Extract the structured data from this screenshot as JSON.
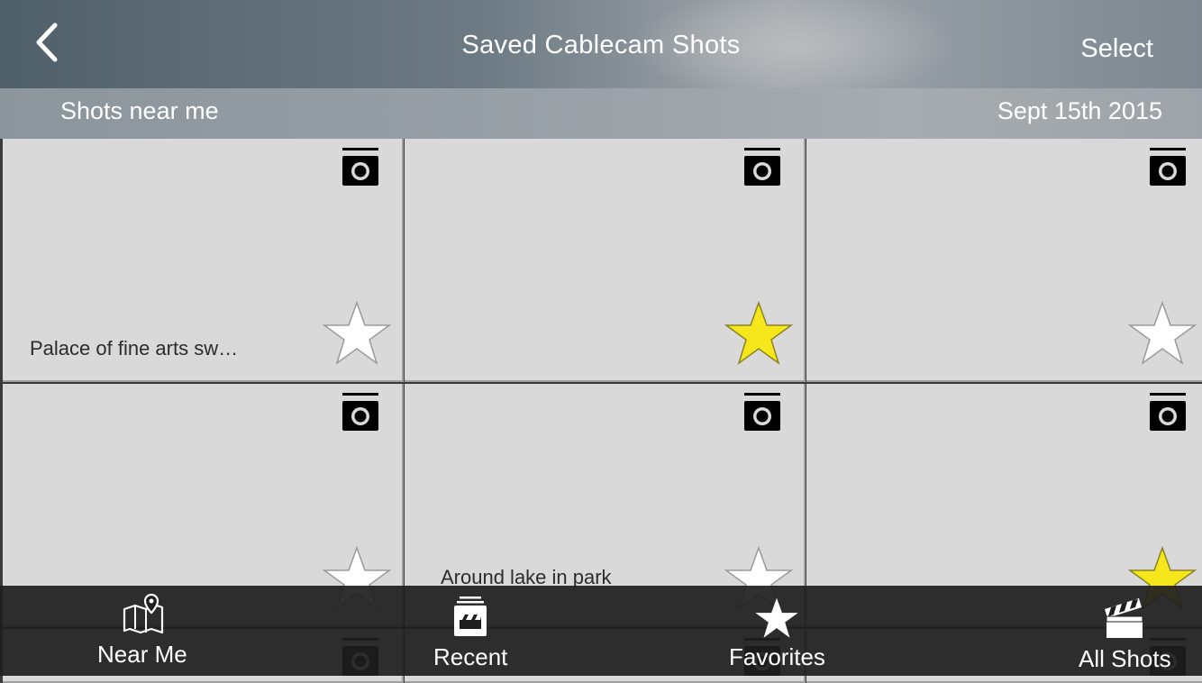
{
  "header": {
    "title": "Saved Cablecam Shots",
    "select_label": "Select",
    "back_icon": "chevron-left-icon"
  },
  "subheader": {
    "left": "Shots near me",
    "right": "Sept 15th 2015"
  },
  "shots": [
    {
      "label": "Palace of fine arts sw…",
      "favorite": false
    },
    {
      "label": "",
      "favorite": true
    },
    {
      "label": "",
      "favorite": false
    },
    {
      "label": "",
      "favorite": false
    },
    {
      "label": "Around lake in park",
      "favorite": false
    },
    {
      "label": "",
      "favorite": true
    }
  ],
  "tabs": [
    {
      "label": "Near Me",
      "icon": "map-pin-icon"
    },
    {
      "label": "Recent",
      "icon": "clapper-stack-icon"
    },
    {
      "label": "Favorites",
      "icon": "star-icon"
    },
    {
      "label": "All Shots",
      "icon": "clapperboard-icon"
    }
  ],
  "colors": {
    "favorite_star": "#f6e61c",
    "empty_star": "#ffffff",
    "cell_bg": "#d9d9d9",
    "tabbar_bg": "#1e1e1e"
  }
}
